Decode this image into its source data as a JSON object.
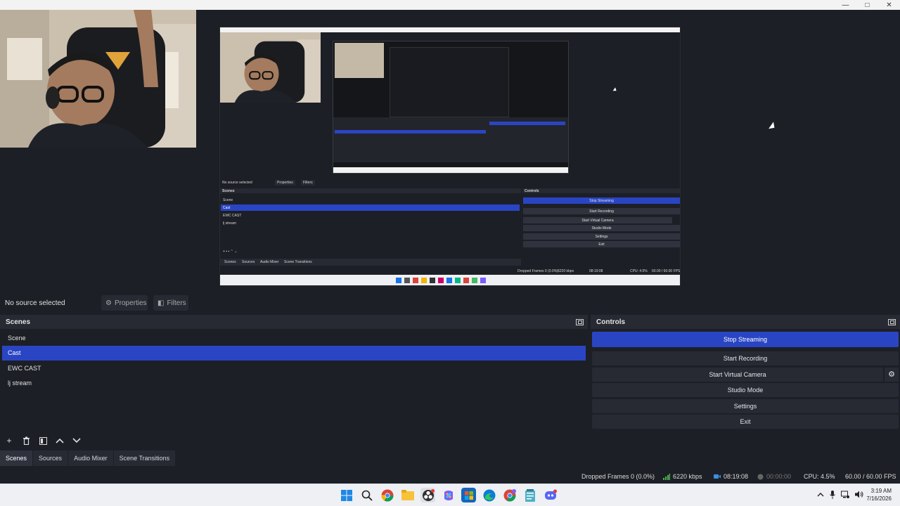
{
  "window": {
    "controls": {
      "minimize": "—",
      "maximize": "□",
      "close": "✕"
    }
  },
  "preview": {
    "nested": {
      "scenes_title": "Scenes",
      "controls_title": "Controls",
      "no_source": "No source selected",
      "properties": "Properties",
      "filters": "Filters",
      "scene_items": [
        "Scene",
        "Cast",
        "EWC CAST",
        "lj stream"
      ],
      "control_items": [
        "Stop Streaming",
        "Start Recording",
        "Start Virtual Camera",
        "Studio Mode",
        "Settings",
        "Exit"
      ],
      "tabs": [
        "Scenes",
        "Sources",
        "Audio Mixer",
        "Scene Transitions"
      ],
      "status": {
        "dropped": "Dropped Frames 0 (0.0%)",
        "kbps": "6220 kbps",
        "time": "08:19:08",
        "cpu": "CPU: 4.5%",
        "fps": "60.00 / 60.00 FPS"
      }
    }
  },
  "propbar": {
    "no_source": "No source selected",
    "properties": "Properties",
    "filters": "Filters"
  },
  "scenes": {
    "title": "Scenes",
    "items": [
      {
        "label": "Scene",
        "active": false
      },
      {
        "label": "Cast",
        "active": true
      },
      {
        "label": "EWC CAST",
        "active": false
      },
      {
        "label": "lj stream",
        "active": false
      }
    ],
    "tools": {
      "add": "+",
      "remove": "🗑",
      "filter": "▦",
      "up": "⌃",
      "down": "⌄"
    }
  },
  "dock_tabs": [
    "Scenes",
    "Sources",
    "Audio Mixer",
    "Scene Transitions"
  ],
  "controls": {
    "title": "Controls",
    "stop_streaming": "Stop Streaming",
    "start_recording": "Start Recording",
    "start_virtual_camera": "Start Virtual Camera",
    "studio_mode": "Studio Mode",
    "settings": "Settings",
    "exit": "Exit"
  },
  "status": {
    "dropped_frames": "Dropped Frames 0 (0.0%)",
    "bitrate": "6220 kbps",
    "stream_time": "08:19:08",
    "record_time": "00:00:00",
    "cpu": "CPU: 4.5%",
    "fps": "60.00 / 60.00 FPS"
  },
  "taskbar": {
    "clock_time": "3:19 AM",
    "clock_date": "7/16/2026"
  },
  "colors": {
    "accent": "#2a45c4",
    "panel": "#272a33",
    "background": "#1d1f26"
  }
}
